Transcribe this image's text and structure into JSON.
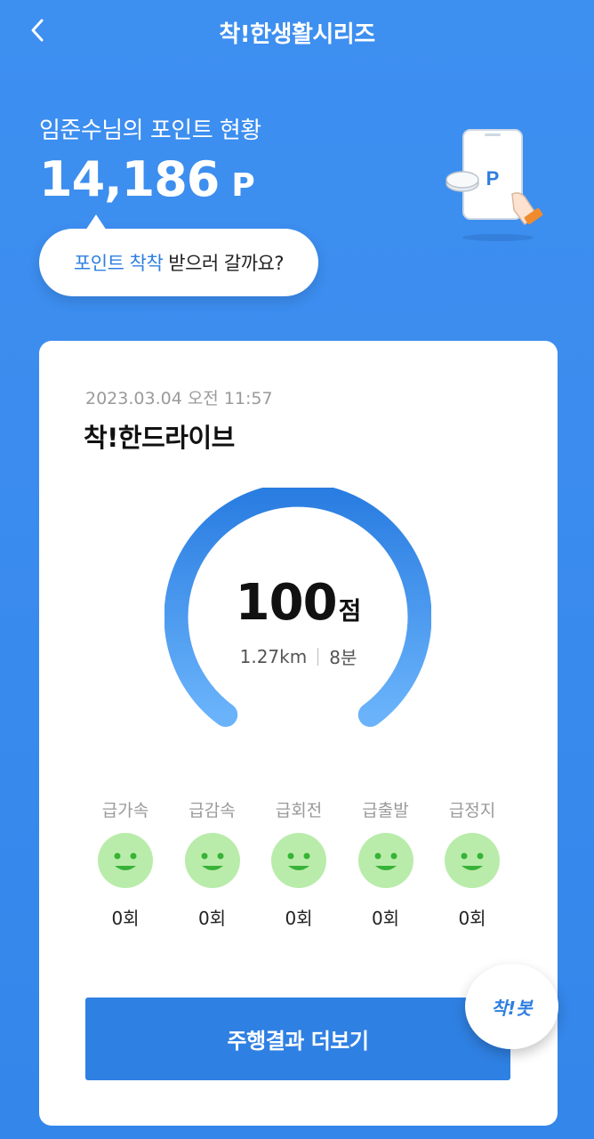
{
  "header": {
    "title": "착!한생활시리즈",
    "back_icon": "chevron-left-icon"
  },
  "points": {
    "label": "임준수님의 포인트 현황",
    "value": "14,186",
    "unit": "P",
    "illustration_label": "P"
  },
  "bubble": {
    "highlight": "포인트 착착",
    "text": "받으러 갈까요?"
  },
  "card": {
    "date": "2023.03.04 오전 11:57",
    "title": "착!한드라이브",
    "score": "100",
    "score_unit": "점",
    "distance": "1.27km",
    "duration": "8분",
    "score_fraction": 1.0,
    "metrics": [
      {
        "label": "급가속",
        "count": "0회",
        "icon": "smiley-icon"
      },
      {
        "label": "급감속",
        "count": "0회",
        "icon": "smiley-icon"
      },
      {
        "label": "급회전",
        "count": "0회",
        "icon": "smiley-icon"
      },
      {
        "label": "급출발",
        "count": "0회",
        "icon": "smiley-icon"
      },
      {
        "label": "급정지",
        "count": "0회",
        "icon": "smiley-icon"
      }
    ],
    "more_button": "주행결과 더보기"
  },
  "fab": {
    "label": "착!봇"
  },
  "colors": {
    "background": "#3b8cee",
    "accent": "#2f80e3",
    "smiley_bg": "#b9ecaa",
    "smiley_fg": "#38b238"
  }
}
